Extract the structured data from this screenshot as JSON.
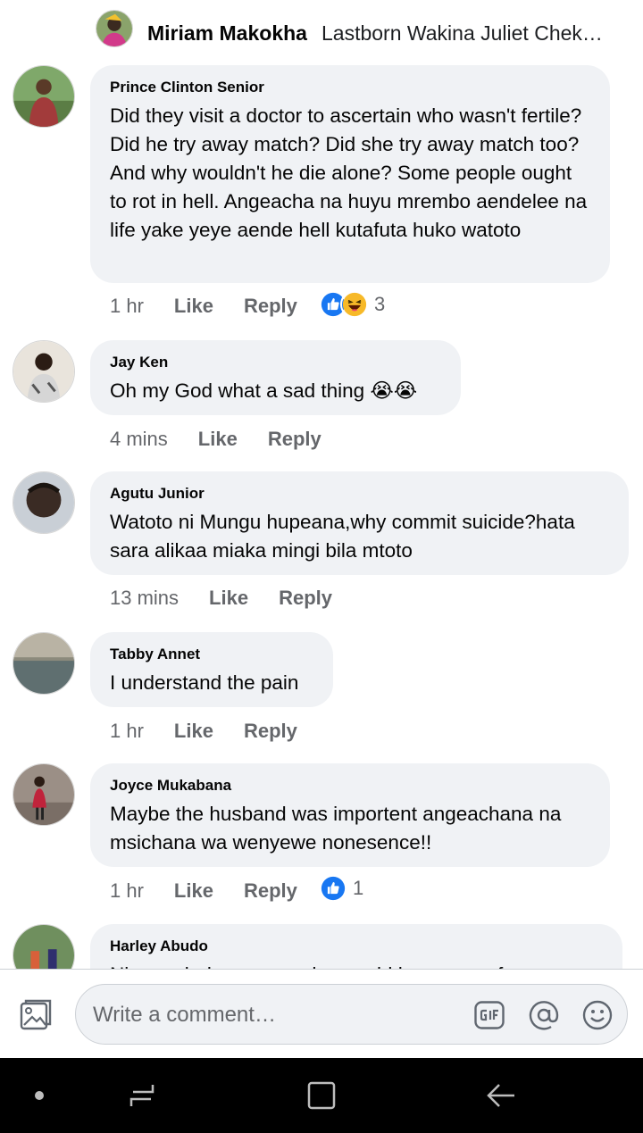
{
  "top_reply": {
    "name": "Miriam Makokha",
    "snippet": "Lastborn Wakina Juliet Chek…"
  },
  "comments": [
    {
      "author": "Prince Clinton Senior",
      "text": "Did they visit a doctor to ascertain who wasn't fertile? Did he try away match? Did she try away match too? And why wouldn't he die alone?  Some people ought to rot in hell. Angeacha na huyu mrembo aendelee na life yake yeye aende hell kutafuta huko watoto",
      "time": "1 hr",
      "like": "Like",
      "reply": "Reply",
      "reaction_count": "3",
      "reactions": [
        "like-reaction-icon",
        "haha-reaction-icon"
      ]
    },
    {
      "author": "Jay Ken",
      "text": "Oh my God what a sad thing",
      "emoji": "😭😭",
      "time": "4 mins",
      "like": "Like",
      "reply": "Reply"
    },
    {
      "author": "Agutu Junior",
      "text": "Watoto ni Mungu hupeana,why commit suicide?hata sara alikaa miaka mingi bila mtoto",
      "time": "13 mins",
      "like": "Like",
      "reply": "Reply"
    },
    {
      "author": "Tabby Annet",
      "text": "I understand the pain",
      "time": "1 hr",
      "like": "Like",
      "reply": "Reply"
    },
    {
      "author": "Joyce Mukabana",
      "text": "Maybe the husband was importent angeachana na msichana wa wenyewe nonesence!!",
      "time": "1 hr",
      "like": "Like",
      "reply": "Reply",
      "reaction_count": "1",
      "reactions": [
        "like-reaction-icon"
      ]
    },
    {
      "author": "Harley Abudo",
      "text": "Ni peee bekwwe naye he would have gone for a very"
    }
  ],
  "composer": {
    "placeholder": "Write a comment…",
    "icons": [
      "photo-icon",
      "gif-icon",
      "at-mention-icon",
      "emoji-icon"
    ]
  },
  "nav_bar": {
    "icons": [
      "dot-icon",
      "recents-icon",
      "home-icon",
      "back-icon"
    ]
  },
  "colors": {
    "bubble": "#f0f2f5",
    "secondary_text": "#65676b",
    "like_blue": "#1877f2",
    "haha_yellow": "#f7b928"
  }
}
